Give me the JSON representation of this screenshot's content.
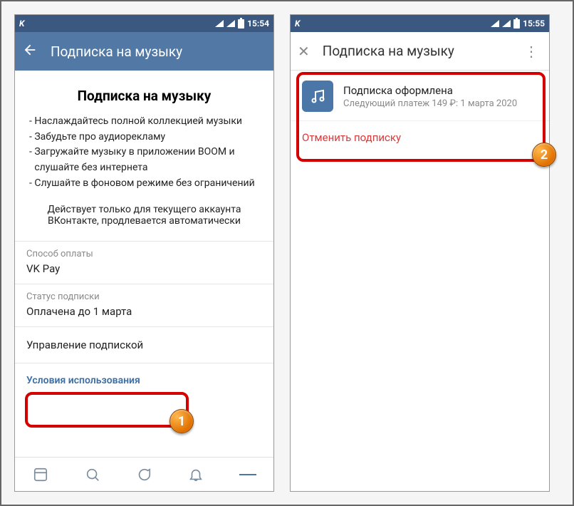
{
  "left": {
    "statusbar": {
      "app": "K",
      "time": "15:54"
    },
    "header": {
      "title": "Подписка на музыку"
    },
    "section_title": "Подписка на музыку",
    "benefits": [
      "Наслаждайтесь полной коллекцией музыки",
      "Забудьте про аудиорекламу",
      "Загружайте музыку в приложении BOOM и слушайте без интернета",
      "Слушайте в фоновом режиме без ограничений"
    ],
    "note": "Действует только для текущего аккаунта ВКонтакте, продлевается автоматически",
    "rows": {
      "method_label": "Способ оплаты",
      "method_value": "VK Pay",
      "status_label": "Статус подписки",
      "status_value": "Оплачена до 1 марта",
      "manage": "Управление подпиской",
      "terms": "Условия использования"
    }
  },
  "right": {
    "statusbar": {
      "app": "K",
      "time": "15:55"
    },
    "header": {
      "title": "Подписка на музыку"
    },
    "card": {
      "title": "Подписка оформлена",
      "subtitle": "Следующий платеж 149 ₽: 1 марта 2020"
    },
    "cancel": "Отменить подписку"
  },
  "badges": {
    "one": "1",
    "two": "2"
  }
}
